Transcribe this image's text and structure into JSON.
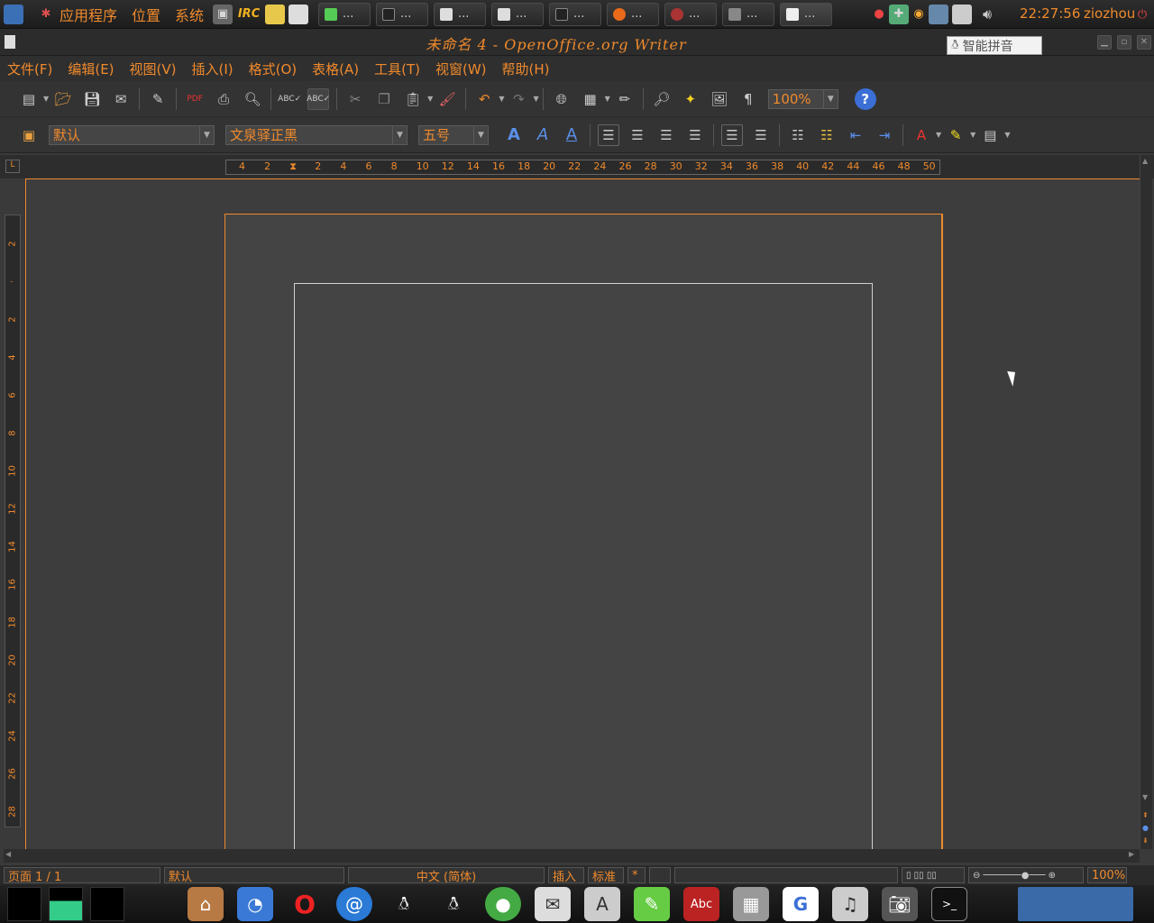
{
  "top_panel": {
    "menus": [
      "应用程序",
      "位置",
      "系统"
    ],
    "tasks": [
      "...",
      "...",
      "...",
      "...",
      "...",
      "...",
      "...",
      "...",
      "..."
    ],
    "clock": "22:27:56",
    "user": "ziozhou"
  },
  "window": {
    "title": "未命名 4 - OpenOffice.org Writer"
  },
  "ime": {
    "label": "智能拼音"
  },
  "menubar": [
    "文件(F)",
    "编辑(E)",
    "视图(V)",
    "插入(I)",
    "格式(O)",
    "表格(A)",
    "工具(T)",
    "视窗(W)",
    "帮助(H)"
  ],
  "toolbar": {
    "zoom": "100%"
  },
  "format": {
    "style": "默认",
    "font": "文泉驿正黑",
    "size": "五号"
  },
  "ruler": {
    "h_ticks": [
      "4",
      "2",
      "",
      "2",
      "4",
      "6",
      "8",
      "10",
      "12",
      "14",
      "16",
      "18",
      "20",
      "22",
      "24",
      "26",
      "28",
      "30",
      "32",
      "34",
      "36",
      "38",
      "40",
      "42",
      "44",
      "46",
      "48",
      "50"
    ],
    "v_ticks": [
      "2",
      "",
      "2",
      "4",
      "6",
      "8",
      "10",
      "12",
      "14",
      "16",
      "18",
      "20",
      "22",
      "24",
      "26",
      "28"
    ]
  },
  "status": {
    "page": "页面 1 / 1",
    "style": "默认",
    "language": "中文 (简体)",
    "mode": "插入",
    "selection": "标准",
    "modified": "*",
    "zoom": "100%"
  },
  "colors": {
    "accent": "#f08a2c",
    "background": "#3a3a3a"
  }
}
